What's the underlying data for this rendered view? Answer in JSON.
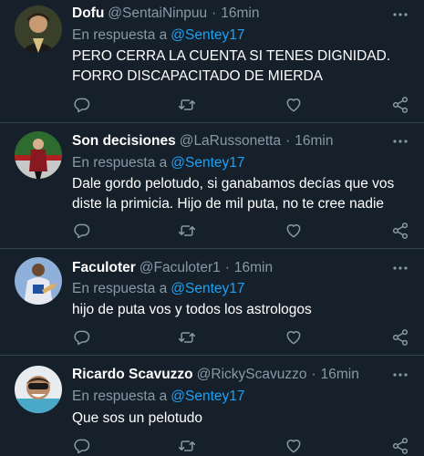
{
  "reply_prefix": "En respuesta a",
  "colors": {
    "background": "#15202b",
    "secondary_text": "#8899a6",
    "link": "#1da1f2",
    "divider": "#38444d"
  },
  "tweets": [
    {
      "name": "Dofu",
      "handle": "@SentaiNinpuu",
      "separator": "·",
      "time": "16min",
      "reply_to": "@Sentey17",
      "text": "PERO CERRA LA CUENTA SI TENES DIGNIDAD.\nFORRO DISCAPACITADO DE MIERDA"
    },
    {
      "name": "Son decisiones",
      "handle": "@LaRussonetta",
      "separator": "·",
      "time": "16min",
      "reply_to": "@Sentey17",
      "text": "Dale gordo pelotudo, si ganabamos decías que vos\ndiste la primicia. Hijo de mil puta, no te cree nadie"
    },
    {
      "name": "Faculoter",
      "handle": "@Faculoter1",
      "separator": "·",
      "time": "16min",
      "reply_to": "@Sentey17",
      "text": "hijo de puta vos y todos los astrologos"
    },
    {
      "name": "Ricardo Scavuzzo",
      "handle": "@RickyScavuzzo",
      "separator": "·",
      "time": "16min",
      "reply_to": "@Sentey17",
      "text": "Que sos un pelotudo"
    }
  ],
  "icons": {
    "more": "more-horizontal-icon",
    "reply": "reply-icon",
    "retweet": "retweet-icon",
    "like": "heart-icon",
    "share": "share-icon"
  }
}
